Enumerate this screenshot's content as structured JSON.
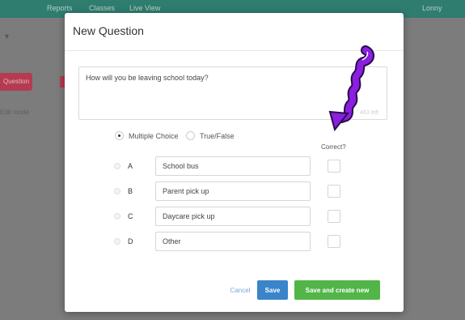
{
  "background": {
    "nav_items": [
      "Reports",
      "Classes",
      "Live View"
    ],
    "nav_right": "Lonny",
    "red_button_label": "Question",
    "side_text": "Edit mode"
  },
  "modal": {
    "title": "New Question",
    "question_text": "How will you be leaving school today?",
    "char_count": "463 left",
    "question_types": [
      {
        "label": "Multiple Choice",
        "selected": true
      },
      {
        "label": "True/False",
        "selected": false
      }
    ],
    "correct_label": "Correct?",
    "answers": [
      {
        "letter": "A",
        "value": "School bus"
      },
      {
        "letter": "B",
        "value": "Parent pick up"
      },
      {
        "letter": "C",
        "value": "Daycare pick up"
      },
      {
        "letter": "D",
        "value": "Other"
      }
    ],
    "buttons": {
      "cancel": "Cancel",
      "save": "Save",
      "save_new": "Save and create new"
    },
    "colors": {
      "save": "#3a84c9",
      "save_new": "#52b548",
      "arrow": "#8a1fe0"
    }
  }
}
